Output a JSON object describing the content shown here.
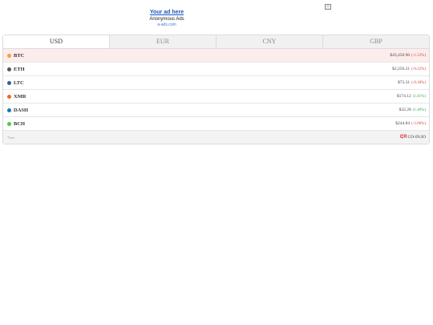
{
  "ad": {
    "title": "Your ad here",
    "subtitle": "Anonymous Ads",
    "url": "a-ads.com",
    "close_glyph": "×"
  },
  "tabs": [
    {
      "label": "USD",
      "active": true
    },
    {
      "label": "EUR",
      "active": false
    },
    {
      "label": "CNY",
      "active": false
    },
    {
      "label": "GBP",
      "active": false
    }
  ],
  "coins": [
    {
      "symbol": "BTC",
      "price": "$43,450.90",
      "change": "(-1.53%)",
      "trend": "negative",
      "icon": "bitcoin-icon",
      "color": "#f2a33a"
    },
    {
      "symbol": "ETH",
      "price": "$2,256.21",
      "change": "(-0.22%)",
      "trend": "negative",
      "icon": "ethereum-icon",
      "color": "#555555"
    },
    {
      "symbol": "LTC",
      "price": "$73.31",
      "change": "(-0.18%)",
      "trend": "negative",
      "icon": "litecoin-icon",
      "color": "#345d9d"
    },
    {
      "symbol": "XMR",
      "price": "$174.12",
      "change": "(1.01%)",
      "trend": "positive",
      "icon": "monero-icon",
      "color": "#f26822"
    },
    {
      "symbol": "DASH",
      "price": "$32.28",
      "change": "(1.40%)",
      "trend": "positive",
      "icon": "dash-icon",
      "color": "#1c75bc"
    },
    {
      "symbol": "BCH",
      "price": "$244.84",
      "change": "(-3.06%)",
      "trend": "negative",
      "icon": "bitcoin-cash-icon",
      "color": "#4cc947"
    }
  ],
  "footer": {
    "free_label": "*free",
    "brand_logo": "₵R",
    "brand_name": "CO-IN.IO"
  }
}
